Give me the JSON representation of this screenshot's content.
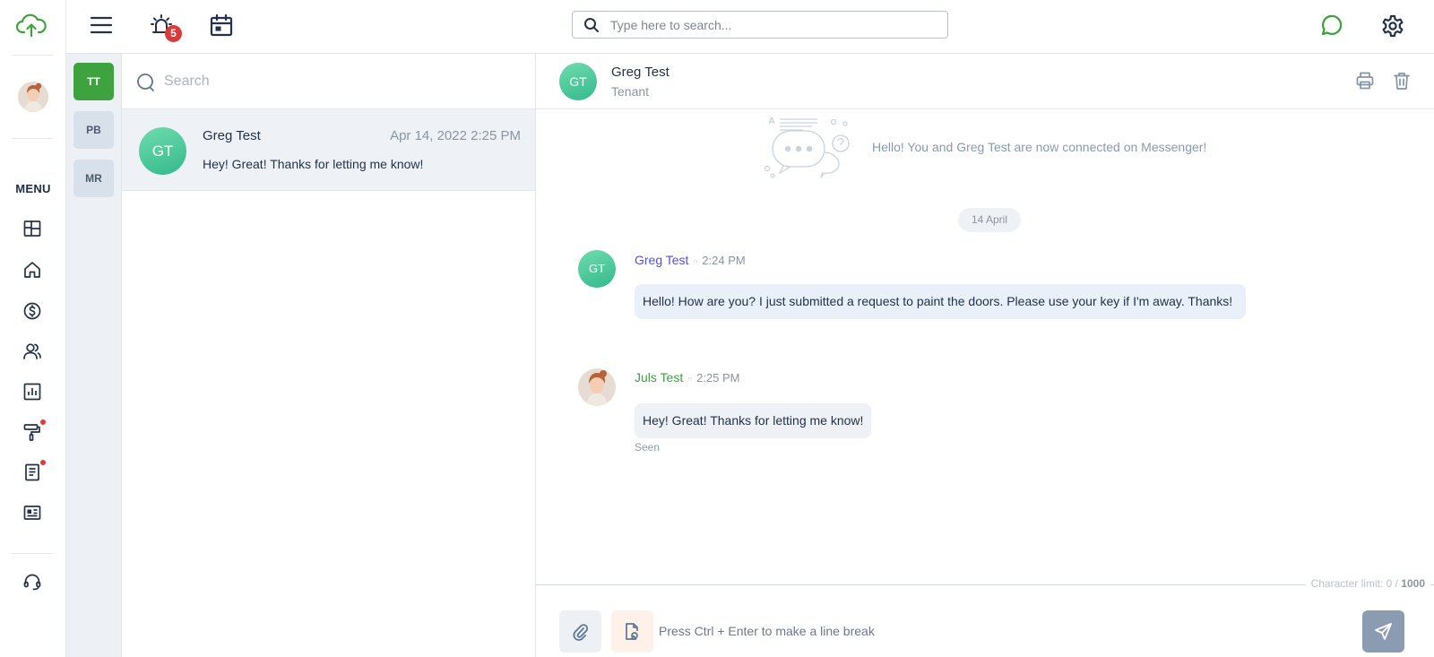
{
  "app": {
    "accent_color": "#3ea33e",
    "logo_icon": "cloud-upload-icon"
  },
  "topbar": {
    "menu_icon": "hamburger-icon",
    "notifications": {
      "icon": "alarm-bell-icon",
      "count": "5"
    },
    "calendar_icon": "calendar-icon",
    "search": {
      "placeholder": "Type here to search..."
    },
    "messenger_icon": "chat-bubble-icon",
    "settings_icon": "gear-icon"
  },
  "sidebar": {
    "menu_label": "MENU",
    "items": [
      {
        "name": "dashboard",
        "icon": "dashboard-icon",
        "has_notification": false
      },
      {
        "name": "properties",
        "icon": "home-icon",
        "has_notification": false
      },
      {
        "name": "payments",
        "icon": "dollar-icon",
        "has_notification": false
      },
      {
        "name": "people",
        "icon": "users-icon",
        "has_notification": false
      },
      {
        "name": "reports",
        "icon": "bar-chart-icon",
        "has_notification": false
      },
      {
        "name": "maintenance",
        "icon": "paint-roller-icon",
        "has_notification": true
      },
      {
        "name": "documents",
        "icon": "document-icon",
        "has_notification": true
      },
      {
        "name": "listings",
        "icon": "id-card-icon",
        "has_notification": false
      }
    ],
    "support_icon": "headset-icon"
  },
  "conversation_tags": [
    {
      "label": "TT",
      "active": true
    },
    {
      "label": "PB",
      "active": false
    },
    {
      "label": "MR",
      "active": false
    }
  ],
  "conversation_list": {
    "search_placeholder": "Search",
    "items": [
      {
        "initials": "GT",
        "name": "Greg Test",
        "date": "Apr 14, 2022 2:25 PM",
        "preview": "Hey! Great! Thanks for letting me know!"
      }
    ]
  },
  "chat": {
    "header": {
      "initials": "GT",
      "name": "Greg Test",
      "role": "Tenant"
    },
    "print_icon": "printer-icon",
    "delete_icon": "trash-icon",
    "connected_text": "Hello! You and Greg Test are now connected on Messenger!",
    "date_divider": "14 April",
    "messages": [
      {
        "initials": "GT",
        "sender": "Greg Test",
        "time": "2:24 PM",
        "text": "Hello! How are you? I just submitted a request to paint the doors. Please use your key if I'm away. Thanks!"
      },
      {
        "sender": "Juls Test",
        "time": "2:25 PM",
        "text": "Hey! Great! Thanks for letting me know!",
        "status": "Seen"
      }
    ],
    "separator": "○",
    "composer": {
      "char_limit_prefix": "Character limit: 0 /",
      "char_limit_max": "1000",
      "placeholder": "Press Ctrl + Enter to make a line break",
      "attach_icon": "paperclip-icon",
      "file_icon": "file-shape-icon",
      "send_icon": "send-icon"
    }
  }
}
